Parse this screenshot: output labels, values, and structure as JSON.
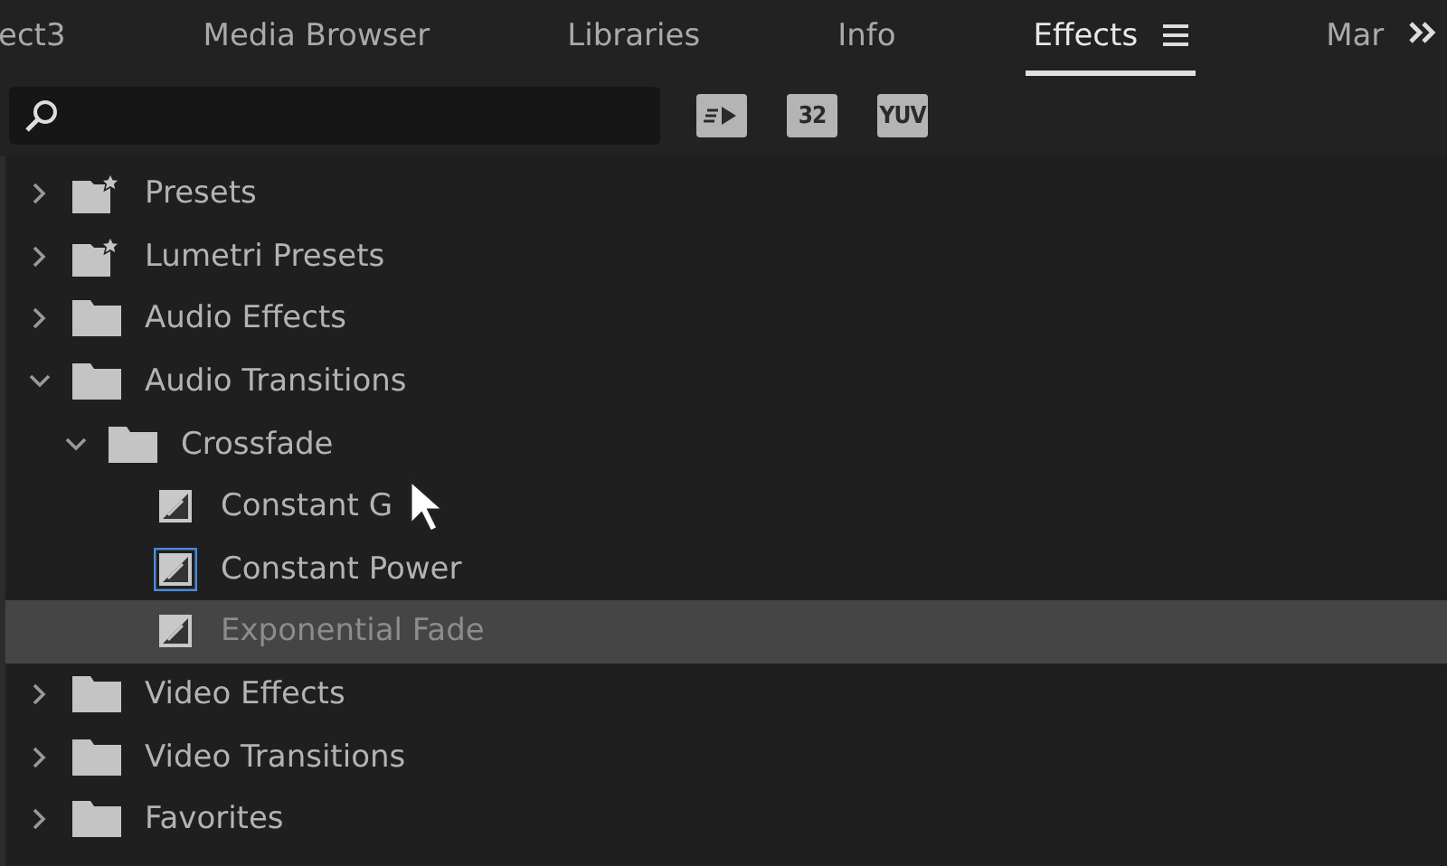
{
  "tabs": [
    {
      "label": "ect3",
      "selected": false
    },
    {
      "label": "Media Browser",
      "selected": false
    },
    {
      "label": "Libraries",
      "selected": false
    },
    {
      "label": "Info",
      "selected": false
    },
    {
      "label": "Effects",
      "selected": true
    },
    {
      "label": "Mar",
      "selected": false
    }
  ],
  "filter_buttons": [
    {
      "kind": "accelerated"
    },
    {
      "kind": "text",
      "label": "32"
    },
    {
      "kind": "text",
      "label": "YUV"
    }
  ],
  "tree": [
    {
      "kind": "star-folder",
      "label": "Presets",
      "expanded": false
    },
    {
      "kind": "star-folder",
      "label": "Lumetri Presets",
      "expanded": false
    },
    {
      "kind": "folder",
      "label": "Audio Effects",
      "expanded": false
    },
    {
      "kind": "folder",
      "label": "Audio Transitions",
      "expanded": true,
      "children": [
        {
          "kind": "folder",
          "label": "Crossfade",
          "expanded": true,
          "children": [
            {
              "kind": "transition",
              "label": "Constant G",
              "default": false,
              "selected": false
            },
            {
              "kind": "transition",
              "label": "Constant Power",
              "default": true,
              "selected": false
            },
            {
              "kind": "transition",
              "label": "Exponential Fade",
              "default": false,
              "selected": true
            }
          ]
        }
      ]
    },
    {
      "kind": "folder",
      "label": "Video Effects",
      "expanded": false
    },
    {
      "kind": "folder",
      "label": "Video Transitions",
      "expanded": false
    },
    {
      "kind": "folder",
      "label": "Favorites",
      "expanded": false
    }
  ]
}
